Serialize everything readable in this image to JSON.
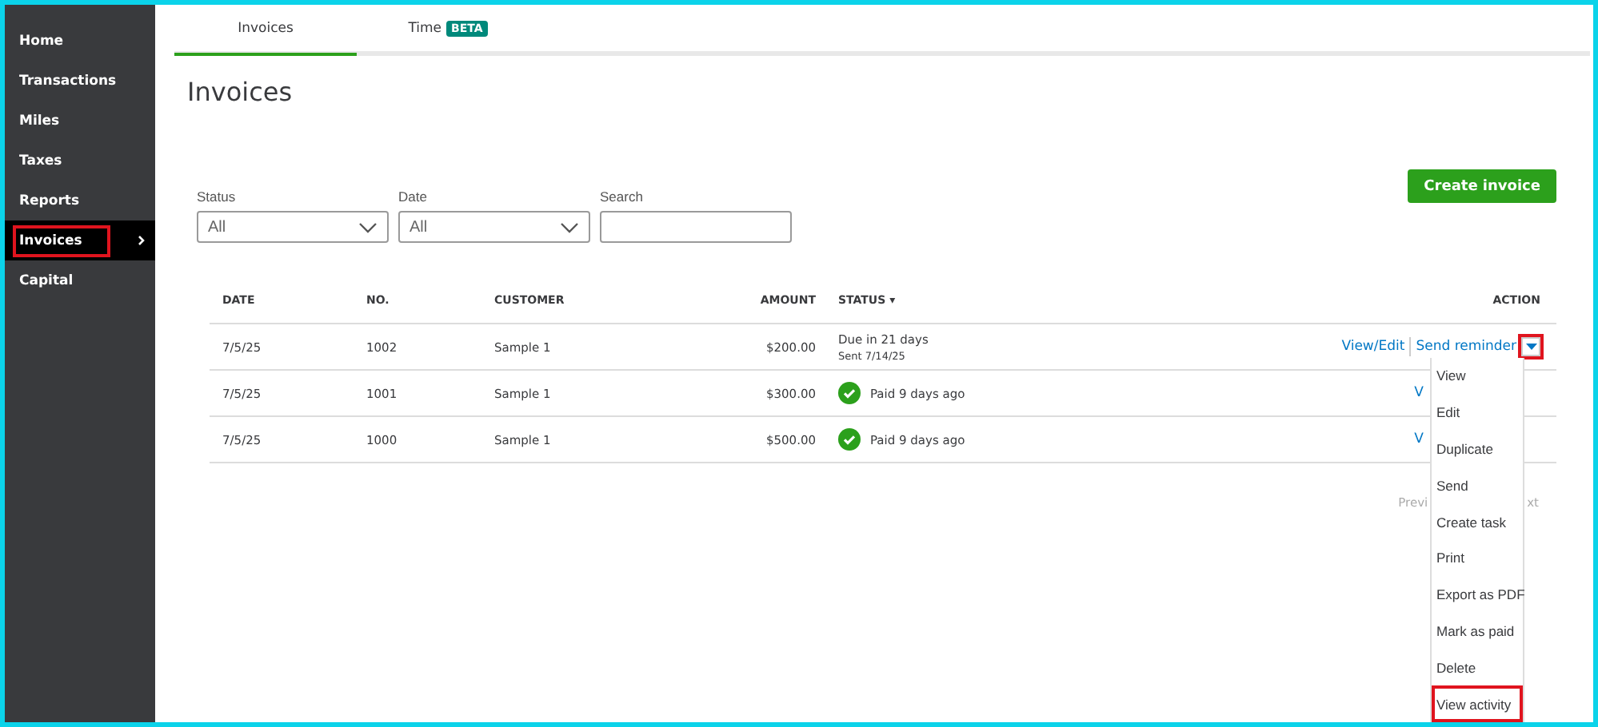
{
  "sidebar": {
    "items": [
      {
        "label": "Home",
        "selected": false,
        "highlighted": false,
        "chevron": false
      },
      {
        "label": "Transactions",
        "selected": false,
        "highlighted": false,
        "chevron": false
      },
      {
        "label": "Miles",
        "selected": false,
        "highlighted": false,
        "chevron": false
      },
      {
        "label": "Taxes",
        "selected": false,
        "highlighted": false,
        "chevron": false
      },
      {
        "label": "Reports",
        "selected": false,
        "highlighted": false,
        "chevron": false
      },
      {
        "label": "Invoices",
        "selected": true,
        "highlighted": true,
        "chevron": true
      },
      {
        "label": "Capital",
        "selected": false,
        "highlighted": false,
        "chevron": false
      }
    ]
  },
  "tabs": [
    {
      "label": "Invoices",
      "selected": true
    },
    {
      "label": "Time",
      "selected": false,
      "badge": "BETA"
    }
  ],
  "title": "Invoices",
  "create_button": "Create invoice",
  "filters": [
    {
      "label": "Status",
      "kind": "select",
      "value": "All"
    },
    {
      "label": "Date",
      "kind": "select",
      "value": "All"
    },
    {
      "label": "Search",
      "kind": "text"
    }
  ],
  "table": {
    "columns": [
      "DATE",
      "NO.",
      "CUSTOMER",
      "AMOUNT",
      "STATUS ▾",
      "ACTION"
    ],
    "rows": [
      {
        "date": "7/5/25",
        "no": "1002",
        "customer": "Sample 1",
        "amount": "$200.00",
        "status": "Due in 21 days",
        "status_sub": "Sent 7/14/25",
        "paid": false,
        "actions": [
          "View/Edit",
          "Send reminder"
        ],
        "dropdown_highlighted": true
      },
      {
        "date": "7/5/25",
        "no": "1001",
        "customer": "Sample 1",
        "amount": "$300.00",
        "status": "Paid 9 days ago",
        "paid": true,
        "actions": [
          "V"
        ]
      },
      {
        "date": "7/5/25",
        "no": "1000",
        "customer": "Sample 1",
        "amount": "$500.00",
        "status": "Paid 9 days ago",
        "paid": true,
        "actions": [
          "V"
        ]
      }
    ]
  },
  "pagination": [
    "Previ",
    "xt"
  ],
  "menu": {
    "items": [
      {
        "label": "View",
        "highlighted": false
      },
      {
        "label": "Edit",
        "highlighted": false
      },
      {
        "label": "Duplicate",
        "highlighted": false
      },
      {
        "label": "Send",
        "highlighted": false
      },
      {
        "label": "Create task",
        "highlighted": false
      },
      {
        "label": "Print",
        "highlighted": false
      },
      {
        "label": "Export as PDF",
        "highlighted": false
      },
      {
        "label": "Mark as paid",
        "highlighted": false
      },
      {
        "label": "Delete",
        "highlighted": false
      },
      {
        "label": "View activity",
        "highlighted": true
      }
    ]
  }
}
